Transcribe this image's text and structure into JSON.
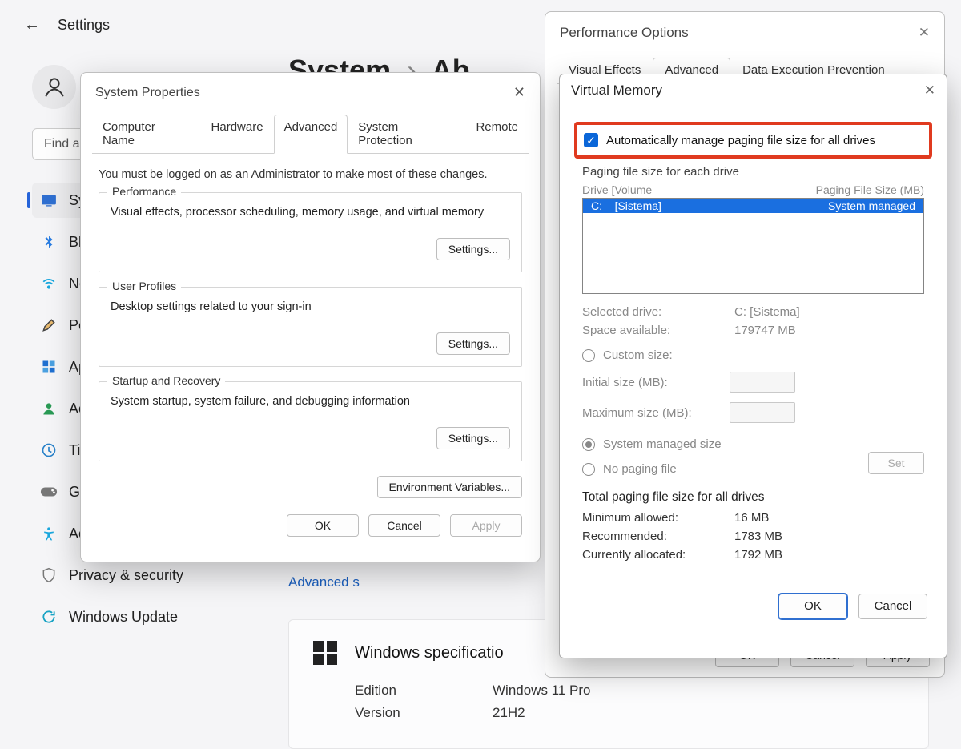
{
  "settings": {
    "title": "Settings",
    "search_placeholder": "Find a s",
    "nav": [
      {
        "icon": "🖥",
        "label": "Sy",
        "selected": true,
        "color": "#2f6fd0"
      },
      {
        "icon": "bt",
        "label": "Bl",
        "color": "#2a7de1"
      },
      {
        "icon": "wifi",
        "label": "Ne",
        "color": "#1aa7dd"
      },
      {
        "icon": "brush",
        "label": "Pe",
        "color": "#444"
      },
      {
        "icon": "apps",
        "label": "Ap",
        "color": "#1f6fd0"
      },
      {
        "icon": "person",
        "label": "Ac",
        "color": "#2a9a55"
      },
      {
        "icon": "clock",
        "label": "Ti",
        "color": "#2a82c9"
      },
      {
        "icon": "game",
        "label": "Ga",
        "color": "#777"
      },
      {
        "icon": "access",
        "label": "Accessibility",
        "color": "#1aa7dd"
      },
      {
        "icon": "shield",
        "label": "Privacy & security",
        "color": "#777"
      },
      {
        "icon": "update",
        "label": "Windows Update",
        "color": "#19a3c4"
      }
    ],
    "crumb_a": "System",
    "crumb_b": "Ab",
    "adv_link": "Advanced s",
    "spec_head": "Windows specificatio",
    "spec_rows": [
      {
        "k": "Edition",
        "v": "Windows 11 Pro"
      },
      {
        "k": "Version",
        "v": "21H2"
      }
    ]
  },
  "sysprops": {
    "title": "System Properties",
    "tabs": [
      "Computer Name",
      "Hardware",
      "Advanced",
      "System Protection",
      "Remote"
    ],
    "active_tab": "Advanced",
    "note": "You must be logged on as an Administrator to make most of these changes.",
    "groups": [
      {
        "legend": "Performance",
        "desc": "Visual effects, processor scheduling, memory usage, and virtual memory",
        "btn": "Settings..."
      },
      {
        "legend": "User Profiles",
        "desc": "Desktop settings related to your sign-in",
        "btn": "Settings..."
      },
      {
        "legend": "Startup and Recovery",
        "desc": "System startup, system failure, and debugging information",
        "btn": "Settings..."
      }
    ],
    "env_btn": "Environment Variables...",
    "ok": "OK",
    "cancel": "Cancel",
    "apply": "Apply"
  },
  "perf": {
    "title": "Performance Options",
    "tabs": [
      "Visual Effects",
      "Advanced",
      "Data Execution Prevention"
    ],
    "active_tab": "Advanced",
    "ok": "OK",
    "cancel": "Cancel",
    "apply": "Apply"
  },
  "vm": {
    "title": "Virtual Memory",
    "auto_label": "Automatically manage paging file size for all drives",
    "auto_checked": true,
    "section_label": "Paging file size for each drive",
    "col_drive": "Drive  [Volume",
    "col_size": "Paging File Size (MB)",
    "drive_row": {
      "drive": "C:",
      "vol": "[Sistema]",
      "size": "System managed"
    },
    "sel_drive_k": "Selected drive:",
    "sel_drive_v": "C:  [Sistema]",
    "space_k": "Space available:",
    "space_v": "179747 MB",
    "custom_label": "Custom size:",
    "init_label": "Initial size (MB):",
    "max_label": "Maximum size (MB):",
    "sys_managed": "System managed size",
    "no_paging": "No paging file",
    "set_btn": "Set",
    "totals_head": "Total paging file size for all drives",
    "totals": [
      {
        "k": "Minimum allowed:",
        "v": "16 MB"
      },
      {
        "k": "Recommended:",
        "v": "1783 MB"
      },
      {
        "k": "Currently allocated:",
        "v": "1792 MB"
      }
    ],
    "ok": "OK",
    "cancel": "Cancel"
  },
  "highlight_color": "#e03a1f"
}
